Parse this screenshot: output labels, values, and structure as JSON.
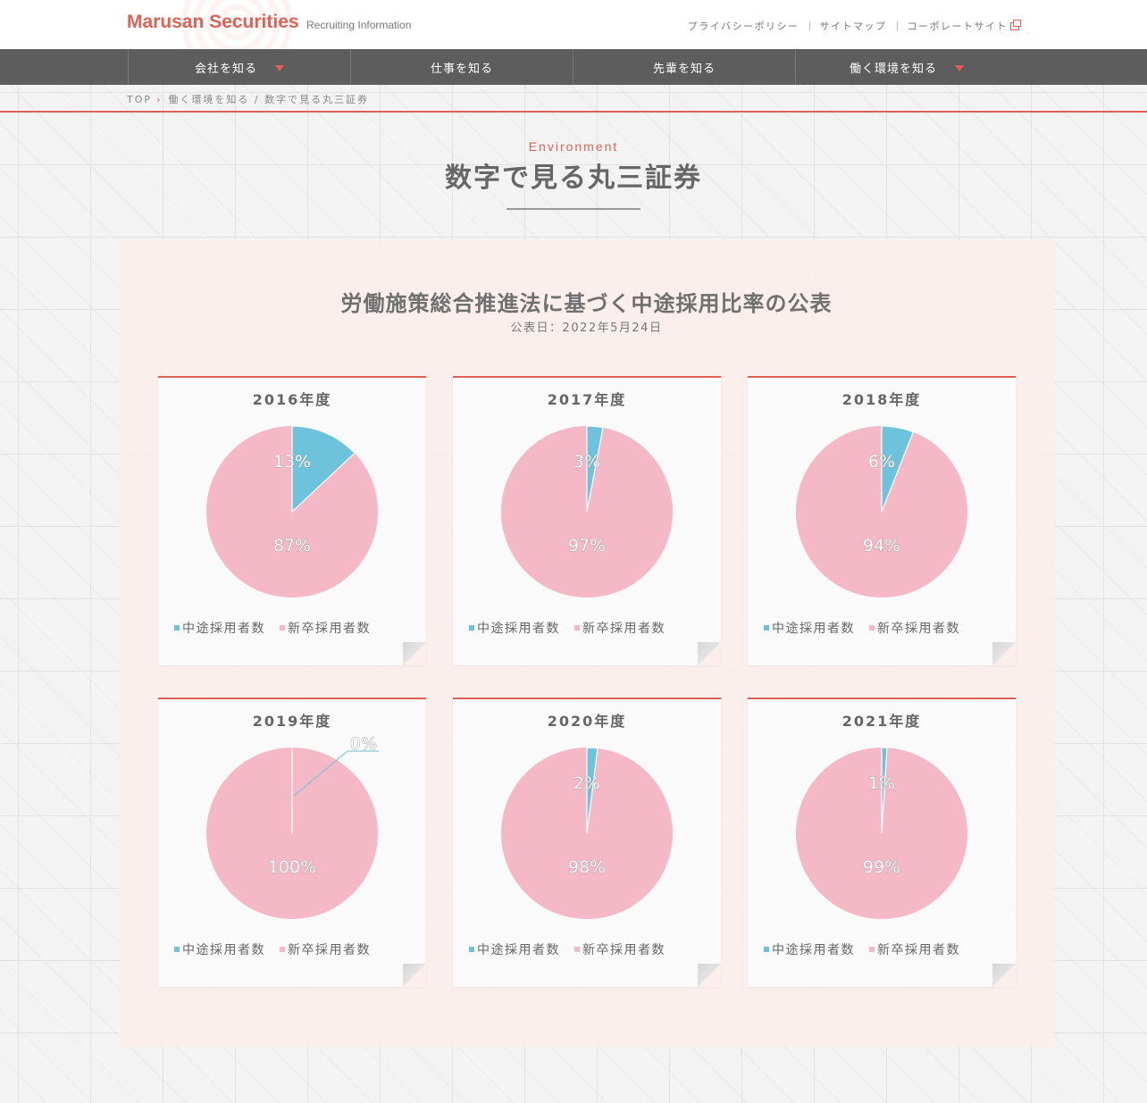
{
  "header": {
    "brand": "Marusan Securities",
    "brand_sub": "Recruiting Information",
    "links": [
      "プライバシーポリシー",
      "サイトマップ",
      "コーポレートサイト"
    ]
  },
  "nav": {
    "items": [
      {
        "label": "会社を知る",
        "has_dropdown": true
      },
      {
        "label": "仕事を知る",
        "has_dropdown": false
      },
      {
        "label": "先輩を知る",
        "has_dropdown": false
      },
      {
        "label": "働く環境を知る",
        "has_dropdown": true
      }
    ]
  },
  "breadcrumb": {
    "home": "TOP",
    "current": "働く環境を知る / 数字で見る丸三証券"
  },
  "page": {
    "eyebrow": "Environment",
    "title": "数字で見る丸三証券"
  },
  "section": {
    "title": "労働施策総合推進法に基づく中途採用比率の公表",
    "date": "公表日：2022年5月24日"
  },
  "legend": {
    "mid_career": "中途採用者数",
    "new_grad": "新卒採用者数"
  },
  "colors": {
    "accent": "#dd6255",
    "mid_career": "#6ec3dc",
    "new_grad": "#f5b8c6",
    "nav_bg": "#5e5d5d"
  },
  "chart_data": [
    {
      "type": "pie",
      "title": "2016年度",
      "categories": [
        "中途採用者数",
        "新卒採用者数"
      ],
      "values": [
        13,
        87
      ],
      "labels": [
        "13%",
        "87%"
      ]
    },
    {
      "type": "pie",
      "title": "2017年度",
      "categories": [
        "中途採用者数",
        "新卒採用者数"
      ],
      "values": [
        3,
        97
      ],
      "labels": [
        "3%",
        "97%"
      ]
    },
    {
      "type": "pie",
      "title": "2018年度",
      "categories": [
        "中途採用者数",
        "新卒採用者数"
      ],
      "values": [
        6,
        94
      ],
      "labels": [
        "6%",
        "94%"
      ]
    },
    {
      "type": "pie",
      "title": "2019年度",
      "categories": [
        "中途採用者数",
        "新卒採用者数"
      ],
      "values": [
        0,
        100
      ],
      "labels": [
        "0%",
        "100%"
      ]
    },
    {
      "type": "pie",
      "title": "2020年度",
      "categories": [
        "中途採用者数",
        "新卒採用者数"
      ],
      "values": [
        2,
        98
      ],
      "labels": [
        "2%",
        "98%"
      ]
    },
    {
      "type": "pie",
      "title": "2021年度",
      "categories": [
        "中途採用者数",
        "新卒採用者数"
      ],
      "values": [
        1,
        99
      ],
      "labels": [
        "1%",
        "99%"
      ]
    }
  ]
}
